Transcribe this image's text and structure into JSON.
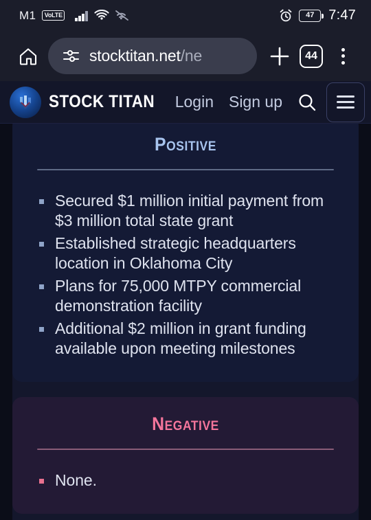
{
  "status_bar": {
    "carrier": "M1",
    "volte_badge": "VoLTE",
    "battery_percent": "47",
    "time": "7:47",
    "icons": [
      "signal-bars-icon",
      "wifi-icon",
      "wifi-calling-icon",
      "alarm-clock-icon",
      "battery-icon"
    ]
  },
  "browser": {
    "home_icon": "home-icon",
    "site_settings_icon": "site-settings-icon",
    "url_main": "stocktitan.net",
    "url_path": "/ne",
    "url_full": "stocktitan.net/ne",
    "new_tab_icon": "plus-icon",
    "tab_count": "44",
    "menu_icon": "three-dot-menu-icon"
  },
  "site_header": {
    "logo_icon": "stock-titan-logo-icon",
    "brand": "STOCK TITAN",
    "login_label": "Login",
    "signup_label": "Sign up",
    "search_icon": "search-icon",
    "menu_icon": "hamburger-menu-icon"
  },
  "content": {
    "positive": {
      "title": "Positive",
      "color": "#a8c4ee",
      "items": [
        "Secured $1 million initial payment from $3 million total state grant",
        "Established strategic headquarters location in Oklahoma City",
        "Plans for 75,000 MTPY commercial demonstration facility",
        "Additional $2 million in grant funding available upon meeting milestones"
      ]
    },
    "negative": {
      "title": "Negative",
      "color": "#f4759b",
      "items": [
        "None."
      ]
    }
  }
}
